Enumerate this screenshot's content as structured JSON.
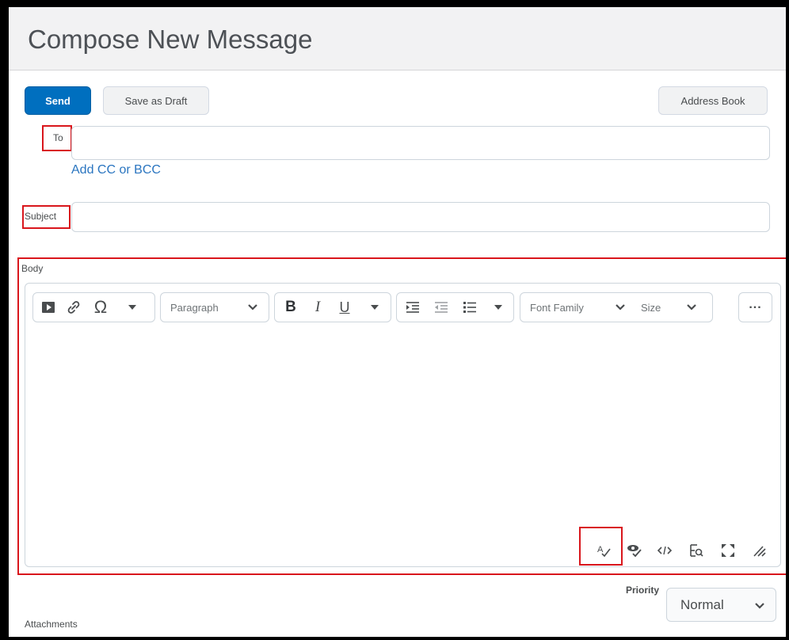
{
  "header": {
    "title": "Compose New Message"
  },
  "actions": {
    "send": "Send",
    "save_draft": "Save as Draft",
    "address_book": "Address Book"
  },
  "to": {
    "label": "To",
    "value": "",
    "add_cc_bcc": "Add CC or BCC"
  },
  "subject": {
    "label": "Subject",
    "value": ""
  },
  "body": {
    "label": "Body",
    "toolbar": {
      "block_format": "Paragraph",
      "font_family": "Font Family",
      "font_size": "Size",
      "bold": "B",
      "italic": "I",
      "underline": "U",
      "more": "..."
    },
    "content": ""
  },
  "priority": {
    "label": "Priority",
    "value": "Normal"
  },
  "attachments": {
    "label": "Attachments"
  },
  "colors": {
    "accent": "#006fbf",
    "highlight": "#d9161c",
    "link": "#2a75c0"
  }
}
